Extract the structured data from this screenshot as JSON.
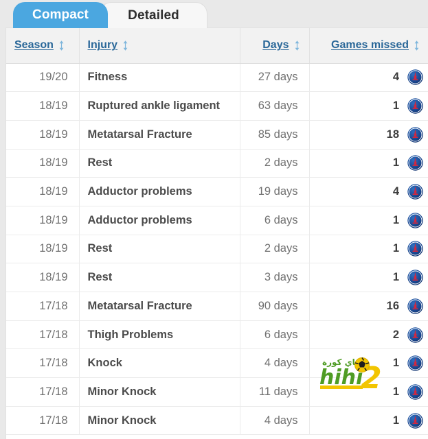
{
  "tabs": [
    {
      "label": "Compact",
      "active": true,
      "name": "tab-compact"
    },
    {
      "label": "Detailed",
      "active": false,
      "name": "tab-detailed"
    }
  ],
  "table": {
    "columns": [
      {
        "key": "season",
        "label": "Season",
        "sort_icon": "sort-updown-icon",
        "align": "left"
      },
      {
        "key": "injury",
        "label": "Injury",
        "sort_icon": "sort-updown-icon",
        "align": "left"
      },
      {
        "key": "days",
        "label": "Days",
        "sort_icon": "sort-updown-icon",
        "align": "right"
      },
      {
        "key": "games",
        "label": "Games missed",
        "sort_icon": "sort-updown-icon",
        "align": "right"
      }
    ],
    "rows": [
      {
        "season": "19/20",
        "injury": "Fitness",
        "days": "27 days",
        "games": "4",
        "club": "club-badge-psg"
      },
      {
        "season": "18/19",
        "injury": "Ruptured ankle ligament",
        "days": "63 days",
        "games": "1",
        "club": "club-badge-psg"
      },
      {
        "season": "18/19",
        "injury": "Metatarsal Fracture",
        "days": "85 days",
        "games": "18",
        "club": "club-badge-psg"
      },
      {
        "season": "18/19",
        "injury": "Rest",
        "days": "2 days",
        "games": "1",
        "club": "club-badge-psg"
      },
      {
        "season": "18/19",
        "injury": "Adductor problems",
        "days": "19 days",
        "games": "4",
        "club": "club-badge-psg"
      },
      {
        "season": "18/19",
        "injury": "Adductor problems",
        "days": "6 days",
        "games": "1",
        "club": "club-badge-psg"
      },
      {
        "season": "18/19",
        "injury": "Rest",
        "days": "2 days",
        "games": "1",
        "club": "club-badge-psg"
      },
      {
        "season": "18/19",
        "injury": "Rest",
        "days": "3 days",
        "games": "1",
        "club": "club-badge-psg"
      },
      {
        "season": "17/18",
        "injury": "Metatarsal Fracture",
        "days": "90 days",
        "games": "16",
        "club": "club-badge-psg"
      },
      {
        "season": "17/18",
        "injury": "Thigh Problems",
        "days": "6 days",
        "games": "2",
        "club": "club-badge-psg"
      },
      {
        "season": "17/18",
        "injury": "Knock",
        "days": "4 days",
        "games": "1",
        "club": "club-badge-psg"
      },
      {
        "season": "17/18",
        "injury": "Minor Knock",
        "days": "11 days",
        "games": "1",
        "club": "club-badge-psg"
      },
      {
        "season": "17/18",
        "injury": "Minor Knock",
        "days": "4 days",
        "games": "1",
        "club": "club-badge-psg"
      }
    ]
  },
  "watermark": {
    "name": "hihi2-watermark",
    "text_latin": "hihi",
    "text_digit": "2",
    "text_arabic": "ماي كورة"
  },
  "colors": {
    "active_tab": "#4ba7e0",
    "header_text": "#2b6899",
    "header_bg": "#f2f2f2",
    "row_text": "#6e6e6e",
    "injury_text": "#4b4b4b",
    "page_bg": "#e9e9e9",
    "watermark_green": "#4f9c24",
    "watermark_yellow": "#f2c500"
  }
}
